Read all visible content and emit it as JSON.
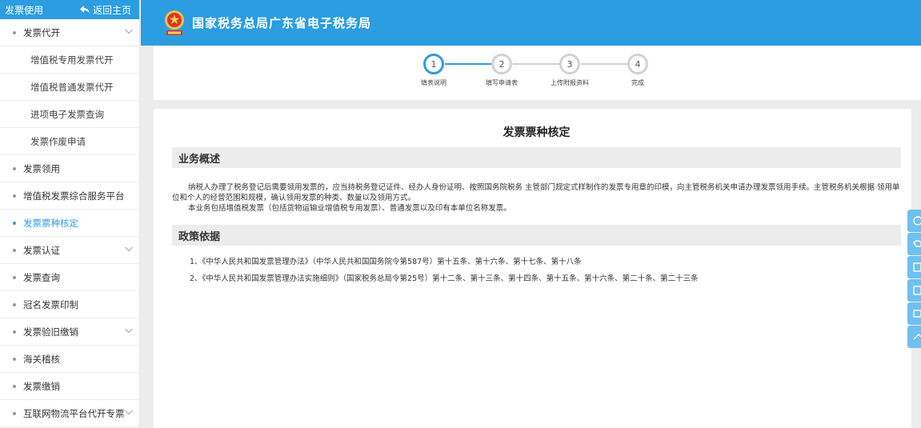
{
  "sidebar": {
    "header_title": "发票使用",
    "back_label": "返回主页",
    "items": [
      {
        "label": "发票代开",
        "type": "group",
        "expandable": true
      },
      {
        "label": "增值税专用发票代开",
        "type": "sub"
      },
      {
        "label": "增值税普通发票代开",
        "type": "sub"
      },
      {
        "label": "进项电子发票查询",
        "type": "sub"
      },
      {
        "label": "发票作废申请",
        "type": "sub"
      },
      {
        "label": "发票领用",
        "type": "group"
      },
      {
        "label": "增值税发票综合服务平台",
        "type": "group"
      },
      {
        "label": "发票票种核定",
        "type": "group",
        "active": true
      },
      {
        "label": "发票认证",
        "type": "group",
        "expandable": true
      },
      {
        "label": "发票查询",
        "type": "group"
      },
      {
        "label": "冠名发票印制",
        "type": "group"
      },
      {
        "label": "发票验旧缴销",
        "type": "group",
        "expandable": true
      },
      {
        "label": "海关稽核",
        "type": "group"
      },
      {
        "label": "发票缴销",
        "type": "group"
      },
      {
        "label": "互联网物流平台代开专票",
        "type": "group",
        "expandable": true
      }
    ]
  },
  "header": {
    "title": "国家税务总局广东省电子税务局"
  },
  "steps": [
    {
      "number": "1",
      "label": "填表说明",
      "current": true
    },
    {
      "number": "2",
      "label": "填写申请表"
    },
    {
      "number": "3",
      "label": "上传附报资料"
    },
    {
      "number": "4",
      "label": "完成"
    }
  ],
  "content": {
    "title": "发票票种核定",
    "overview": {
      "heading": "业务概述",
      "p1": "纳税人办理了税务登记后需要领用发票的，应当持税务登记证件、经办人身份证明、按照国务院税务 主管部门规定式样制作的发票专用章的印模，向主管税务机关申请办理发票领用手续。主管税务机关根据 领用单位和个人的经营范围和规模，确认领用发票的种类、数量以及领用方式。",
      "p2": "本业务包括增值税发票（包括货物运输业增值税专用发票）、普通发票以及印有本单位名称发票。"
    },
    "policy": {
      "heading": "政策依据",
      "items": [
        "1、《中华人民共和国发票管理办法》（中华人民共和国国务院令第587号）第十五条、第十六条、第十七条、第十八条",
        "2、《中华人民共和国发票管理办法实施细则》（国家税务总局令第25号）第十二条、第十三条、第十四条、第十五条、第十六条、第二十条、第二十三条"
      ]
    }
  },
  "colors": {
    "brand_blue": "#2b9de0",
    "tool_blue": "#6ec0ef",
    "section_bg": "#ececec"
  },
  "icons": {
    "back": "back-arrow-icon",
    "chevron": "chevron-down-icon",
    "emblem": "national-emblem-icon"
  }
}
